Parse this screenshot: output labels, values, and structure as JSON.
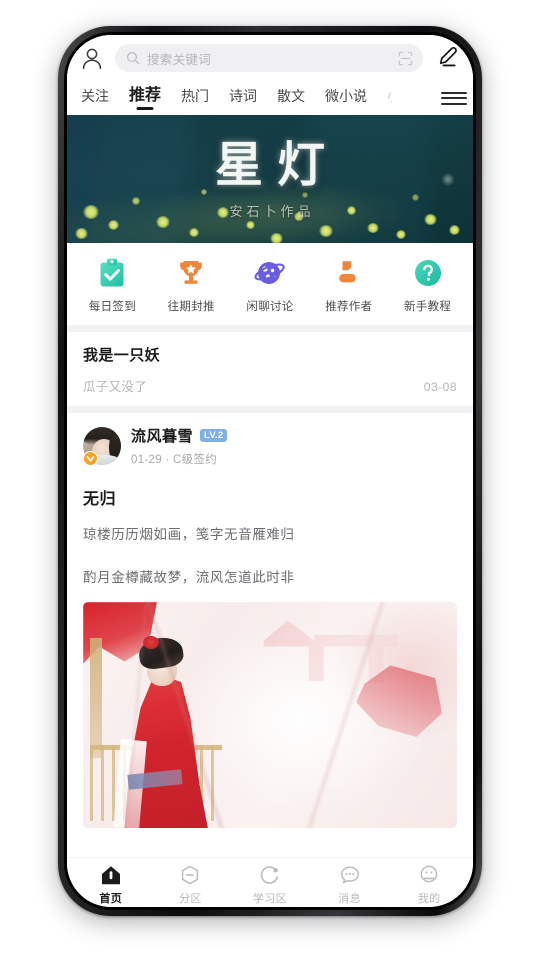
{
  "topbar": {
    "profile_icon": "user-outline-icon",
    "search": {
      "placeholder": "搜索关键词",
      "icon": "search-icon",
      "scan_icon": "scan-qr-icon"
    },
    "compose_icon": "pencil-edit-icon"
  },
  "tabs": {
    "items": [
      {
        "label": "关注",
        "active": false
      },
      {
        "label": "推荐",
        "active": true
      },
      {
        "label": "热门",
        "active": false
      },
      {
        "label": "诗词",
        "active": false
      },
      {
        "label": "散文",
        "active": false
      },
      {
        "label": "微小说",
        "active": false
      },
      {
        "label": "小",
        "active": false
      }
    ],
    "menu_icon": "hamburger-menu-icon"
  },
  "banner": {
    "title": "星灯",
    "subtitle": "安石卜作品",
    "bg_color": "#14414a",
    "glow_color": "#c3d663"
  },
  "quick_actions": [
    {
      "label": "每日签到",
      "icon": "clipboard-check-icon",
      "color": "#3fd1b1"
    },
    {
      "label": "往期封推",
      "icon": "trophy-icon",
      "color": "#f0853c"
    },
    {
      "label": "闲聊讨论",
      "icon": "planet-icon",
      "color": "#6b5ce0"
    },
    {
      "label": "推荐作者",
      "icon": "person-icon",
      "color": "#f0853c"
    },
    {
      "label": "新手教程",
      "icon": "question-circle-icon",
      "color": "#2ec4aa"
    }
  ],
  "announcement": {
    "title": "我是一只妖",
    "subtitle": "瓜子又没了",
    "date": "03-08"
  },
  "post": {
    "author": "流风暮雪",
    "level_badge": "LV.2",
    "level_badge_color": "#7fb0e8",
    "verified_icon": "verified-v-icon",
    "verified_color": "#f7a52a",
    "meta": "01-29 · C级签约",
    "title": "无归",
    "lines": [
      "琼楼历历烟如画，笺字无音雁难归",
      "酌月金樽藏故梦，流风怎道此时非"
    ],
    "image_alt": "traditional-chinese-painting"
  },
  "bottom_nav": [
    {
      "label": "首页",
      "icon": "home-icon",
      "active": true
    },
    {
      "label": "分区",
      "icon": "hexagon-minus-icon",
      "active": false
    },
    {
      "label": "学习区",
      "icon": "circle-arc-icon",
      "active": false
    },
    {
      "label": "消息",
      "icon": "chat-bubble-icon",
      "active": false
    },
    {
      "label": "我的",
      "icon": "face-profile-icon",
      "active": false
    }
  ]
}
